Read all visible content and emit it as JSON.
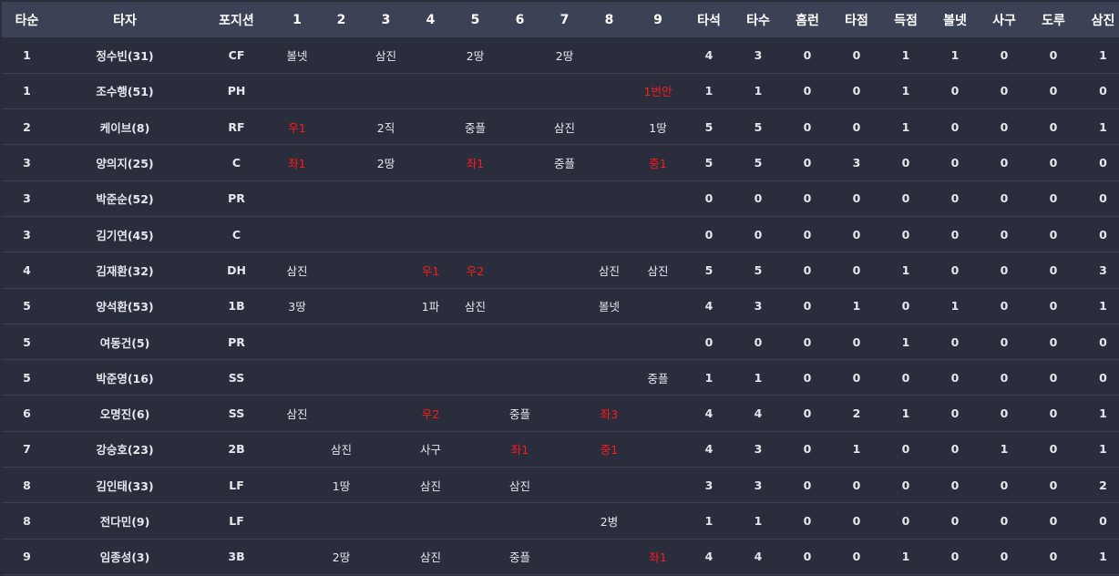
{
  "header": [
    "타순",
    "타자",
    "포지션",
    "1",
    "2",
    "3",
    "4",
    "5",
    "6",
    "7",
    "8",
    "9",
    "타석",
    "타수",
    "홈런",
    "타점",
    "득점",
    "볼넷",
    "사구",
    "도루",
    "삼진"
  ],
  "colors": {
    "background": "#2a2d3b",
    "header_bg": "#3c4255",
    "text": "#e6e7ee",
    "highlight": "#ff1a1a"
  },
  "rows": [
    {
      "order": "1",
      "name": "정수빈(31)",
      "pos": "CF",
      "innings": [
        "볼넷",
        "",
        "삼진",
        "",
        "2땅",
        "",
        "2땅",
        "",
        ""
      ],
      "hl": [],
      "stats": [
        "4",
        "3",
        "0",
        "0",
        "1",
        "1",
        "0",
        "0",
        "1"
      ]
    },
    {
      "order": "1",
      "name": "조수행(51)",
      "pos": "PH",
      "innings": [
        "",
        "",
        "",
        "",
        "",
        "",
        "",
        "",
        "1번안"
      ],
      "hl": [
        8
      ],
      "stats": [
        "1",
        "1",
        "0",
        "0",
        "1",
        "0",
        "0",
        "0",
        "0"
      ]
    },
    {
      "order": "2",
      "name": "케이브(8)",
      "pos": "RF",
      "innings": [
        "우1",
        "",
        "2직",
        "",
        "중플",
        "",
        "삼진",
        "",
        "1땅"
      ],
      "hl": [
        0
      ],
      "stats": [
        "5",
        "5",
        "0",
        "0",
        "1",
        "0",
        "0",
        "0",
        "1"
      ]
    },
    {
      "order": "3",
      "name": "양의지(25)",
      "pos": "C",
      "innings": [
        "좌1",
        "",
        "2땅",
        "",
        "좌1",
        "",
        "중플",
        "",
        "중1"
      ],
      "hl": [
        0,
        4,
        8
      ],
      "stats": [
        "5",
        "5",
        "0",
        "3",
        "0",
        "0",
        "0",
        "0",
        "0"
      ]
    },
    {
      "order": "3",
      "name": "박준순(52)",
      "pos": "PR",
      "innings": [
        "",
        "",
        "",
        "",
        "",
        "",
        "",
        "",
        ""
      ],
      "hl": [],
      "stats": [
        "0",
        "0",
        "0",
        "0",
        "0",
        "0",
        "0",
        "0",
        "0"
      ]
    },
    {
      "order": "3",
      "name": "김기연(45)",
      "pos": "C",
      "innings": [
        "",
        "",
        "",
        "",
        "",
        "",
        "",
        "",
        ""
      ],
      "hl": [],
      "stats": [
        "0",
        "0",
        "0",
        "0",
        "0",
        "0",
        "0",
        "0",
        "0"
      ]
    },
    {
      "order": "4",
      "name": "김재환(32)",
      "pos": "DH",
      "innings": [
        "삼진",
        "",
        "",
        "우1",
        "우2",
        "",
        "",
        "삼진",
        "삼진"
      ],
      "hl": [
        3,
        4
      ],
      "stats": [
        "5",
        "5",
        "0",
        "0",
        "1",
        "0",
        "0",
        "0",
        "3"
      ]
    },
    {
      "order": "5",
      "name": "양석환(53)",
      "pos": "1B",
      "innings": [
        "3땅",
        "",
        "",
        "1파",
        "삼진",
        "",
        "",
        "볼넷",
        ""
      ],
      "hl": [],
      "stats": [
        "4",
        "3",
        "0",
        "1",
        "0",
        "1",
        "0",
        "0",
        "1"
      ]
    },
    {
      "order": "5",
      "name": "여동건(5)",
      "pos": "PR",
      "innings": [
        "",
        "",
        "",
        "",
        "",
        "",
        "",
        "",
        ""
      ],
      "hl": [],
      "stats": [
        "0",
        "0",
        "0",
        "0",
        "1",
        "0",
        "0",
        "0",
        "0"
      ]
    },
    {
      "order": "5",
      "name": "박준영(16)",
      "pos": "SS",
      "innings": [
        "",
        "",
        "",
        "",
        "",
        "",
        "",
        "",
        "중플"
      ],
      "hl": [],
      "stats": [
        "1",
        "1",
        "0",
        "0",
        "0",
        "0",
        "0",
        "0",
        "0"
      ]
    },
    {
      "order": "6",
      "name": "오명진(6)",
      "pos": "SS",
      "innings": [
        "삼진",
        "",
        "",
        "우2",
        "",
        "중플",
        "",
        "좌3",
        ""
      ],
      "hl": [
        3,
        7
      ],
      "stats": [
        "4",
        "4",
        "0",
        "2",
        "1",
        "0",
        "0",
        "0",
        "1"
      ]
    },
    {
      "order": "7",
      "name": "강승호(23)",
      "pos": "2B",
      "innings": [
        "",
        "삼진",
        "",
        "사구",
        "",
        "좌1",
        "",
        "중1",
        ""
      ],
      "hl": [
        5,
        7
      ],
      "stats": [
        "4",
        "3",
        "0",
        "1",
        "0",
        "0",
        "1",
        "0",
        "1"
      ]
    },
    {
      "order": "8",
      "name": "김인태(33)",
      "pos": "LF",
      "innings": [
        "",
        "1땅",
        "",
        "삼진",
        "",
        "삼진",
        "",
        "",
        ""
      ],
      "hl": [],
      "stats": [
        "3",
        "3",
        "0",
        "0",
        "0",
        "0",
        "0",
        "0",
        "2"
      ]
    },
    {
      "order": "8",
      "name": "전다민(9)",
      "pos": "LF",
      "innings": [
        "",
        "",
        "",
        "",
        "",
        "",
        "",
        "2병",
        ""
      ],
      "hl": [],
      "stats": [
        "1",
        "1",
        "0",
        "0",
        "0",
        "0",
        "0",
        "0",
        "0"
      ]
    },
    {
      "order": "9",
      "name": "임종성(3)",
      "pos": "3B",
      "innings": [
        "",
        "2땅",
        "",
        "삼진",
        "",
        "중플",
        "",
        "",
        "좌1"
      ],
      "hl": [
        8
      ],
      "stats": [
        "4",
        "4",
        "0",
        "0",
        "1",
        "0",
        "0",
        "0",
        "1"
      ]
    }
  ]
}
